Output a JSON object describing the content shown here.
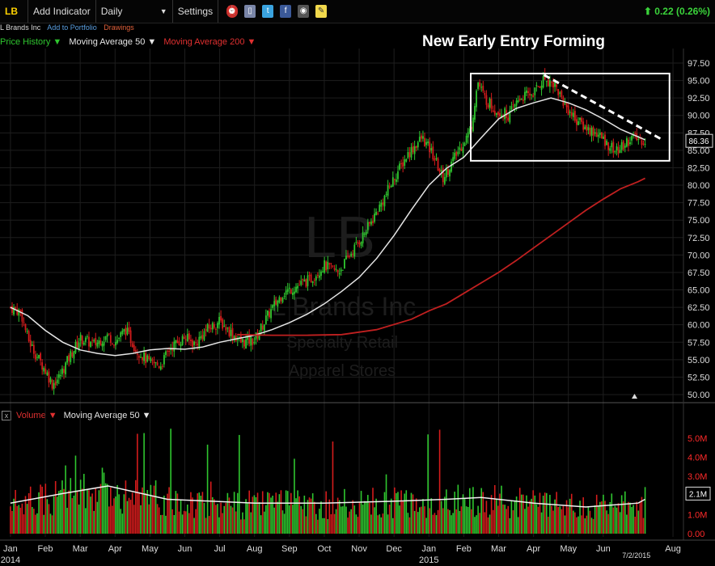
{
  "toolbar": {
    "symbol": "LB",
    "add_indicator": "Add Indicator",
    "period": "Daily",
    "period_arrow": "▼",
    "settings": "Settings",
    "change": "0.22 (0.26%)",
    "change_arrow": "⬆",
    "icons": [
      "alarm-icon",
      "mobile-icon",
      "twitter-icon",
      "facebook-icon",
      "camera-icon",
      "note-icon"
    ]
  },
  "company": {
    "name": "L Brands Inc",
    "add_portfolio": "Add to Portfolio",
    "drawings": "Drawings"
  },
  "legend": {
    "price_history": "Price History ▼",
    "ma50": "Moving Average 50 ▼",
    "ma200": "Moving Average 200 ▼"
  },
  "volume_legend": {
    "close": "x",
    "volume": "Volume ▼",
    "ma50": "Moving Average 50 ▼"
  },
  "colors": {
    "up": "#2fc62f",
    "down": "#d41c1c",
    "ma50": "#e6e6e6",
    "ma200": "#c02020",
    "price_axis": "#dddddd",
    "vol_axis": "#ff2a2a"
  },
  "chart_data": {
    "type": "candlestick",
    "title": "New Early Entry Forming",
    "watermark": {
      "symbol": "LB",
      "name": "L Brands Inc",
      "sector": "Specialty Retail",
      "industry": "Apparel Stores"
    },
    "last_price": "86.36",
    "last_volume": "2.1M",
    "date_label": "7/2/2015",
    "x_labels": [
      {
        "label": "Jan",
        "t": 0
      },
      {
        "label": "Feb",
        "t": 1
      },
      {
        "label": "Mar",
        "t": 2
      },
      {
        "label": "Apr",
        "t": 3
      },
      {
        "label": "May",
        "t": 4
      },
      {
        "label": "Jun",
        "t": 5
      },
      {
        "label": "Jul",
        "t": 6
      },
      {
        "label": "Aug",
        "t": 7
      },
      {
        "label": "Sep",
        "t": 8
      },
      {
        "label": "Oct",
        "t": 9
      },
      {
        "label": "Nov",
        "t": 10
      },
      {
        "label": "Dec",
        "t": 11
      },
      {
        "label": "Jan",
        "t": 12
      },
      {
        "label": "Feb",
        "t": 13
      },
      {
        "label": "Mar",
        "t": 14
      },
      {
        "label": "Apr",
        "t": 15
      },
      {
        "label": "May",
        "t": 16
      },
      {
        "label": "Jun",
        "t": 17
      },
      {
        "label": "Aug",
        "t": 19
      }
    ],
    "year_labels": [
      {
        "label": "2014",
        "t": 0
      },
      {
        "label": "2015",
        "t": 12
      }
    ],
    "x_range_months": [
      -0.3,
      19.3
    ],
    "y_ticks": [
      "97.50",
      "95.00",
      "92.50",
      "90.00",
      "87.50",
      "85.00",
      "82.50",
      "80.00",
      "77.50",
      "75.00",
      "72.50",
      "70.00",
      "67.50",
      "65.00",
      "62.50",
      "60.00",
      "57.50",
      "55.00",
      "52.50",
      "50.00"
    ],
    "ylim": [
      50.0,
      97.5
    ],
    "price_path": [
      [
        0,
        62.5
      ],
      [
        0.3,
        61.8
      ],
      [
        0.5,
        58
      ],
      [
        0.7,
        56
      ],
      [
        1.0,
        53.5
      ],
      [
        1.2,
        51.5
      ],
      [
        1.4,
        52.5
      ],
      [
        1.7,
        55.5
      ],
      [
        2.0,
        58
      ],
      [
        2.4,
        57.2
      ],
      [
        2.8,
        58.5
      ],
      [
        3.0,
        57.5
      ],
      [
        3.3,
        59.3
      ],
      [
        3.6,
        56.5
      ],
      [
        4.0,
        54.5
      ],
      [
        4.3,
        54.2
      ],
      [
        4.6,
        56.8
      ],
      [
        5.0,
        58.2
      ],
      [
        5.3,
        57.2
      ],
      [
        5.6,
        59.2
      ],
      [
        6.0,
        60.5
      ],
      [
        6.3,
        59
      ],
      [
        6.6,
        57.5
      ],
      [
        7.0,
        57.8
      ],
      [
        7.4,
        61.5
      ],
      [
        7.8,
        64.5
      ],
      [
        8.2,
        65.5
      ],
      [
        8.6,
        66.5
      ],
      [
        9.0,
        68.5
      ],
      [
        9.4,
        67.5
      ],
      [
        9.8,
        70.5
      ],
      [
        10.2,
        73.5
      ],
      [
        10.6,
        77
      ],
      [
        11.0,
        81
      ],
      [
        11.4,
        84.5
      ],
      [
        11.8,
        86.8
      ],
      [
        12.1,
        84.5
      ],
      [
        12.4,
        81
      ],
      [
        12.8,
        84.5
      ],
      [
        13.2,
        88
      ],
      [
        13.4,
        94.8
      ],
      [
        13.6,
        92.5
      ],
      [
        13.9,
        90.8
      ],
      [
        14.3,
        90
      ],
      [
        14.6,
        92.5
      ],
      [
        15.0,
        93.2
      ],
      [
        15.3,
        95.3
      ],
      [
        15.6,
        94.5
      ],
      [
        15.9,
        91.5
      ],
      [
        16.2,
        89.5
      ],
      [
        16.5,
        88.2
      ],
      [
        16.8,
        87.5
      ],
      [
        17.1,
        86
      ],
      [
        17.4,
        84.8
      ],
      [
        17.8,
        86.8
      ],
      [
        18.2,
        86.36
      ]
    ],
    "ma50_path": [
      [
        0,
        62.5
      ],
      [
        0.5,
        61.3
      ],
      [
        1.0,
        59.2
      ],
      [
        1.5,
        57.5
      ],
      [
        2.0,
        56.4
      ],
      [
        2.5,
        55.9
      ],
      [
        3.0,
        55.6
      ],
      [
        3.5,
        55.9
      ],
      [
        4.0,
        56.4
      ],
      [
        4.5,
        56.6
      ],
      [
        5.0,
        56.5
      ],
      [
        5.5,
        56.8
      ],
      [
        6.0,
        57.5
      ],
      [
        6.5,
        58.0
      ],
      [
        7.0,
        58.5
      ],
      [
        7.5,
        59.3
      ],
      [
        8.0,
        60.3
      ],
      [
        8.5,
        61.5
      ],
      [
        9.0,
        63.0
      ],
      [
        9.5,
        64.8
      ],
      [
        10.0,
        66.8
      ],
      [
        10.5,
        69.5
      ],
      [
        11.0,
        72.8
      ],
      [
        11.5,
        76.5
      ],
      [
        12.0,
        80.0
      ],
      [
        12.5,
        82.4
      ],
      [
        13.0,
        84.0
      ],
      [
        13.5,
        86.8
      ],
      [
        14.0,
        89.5
      ],
      [
        14.5,
        91.0
      ],
      [
        15.0,
        91.8
      ],
      [
        15.5,
        92.5
      ],
      [
        16.0,
        91.8
      ],
      [
        16.5,
        90.8
      ],
      [
        17.0,
        89.5
      ],
      [
        17.5,
        88.0
      ],
      [
        18.2,
        86.5
      ]
    ],
    "ma200_path": [
      [
        6.5,
        58.6
      ],
      [
        7.5,
        58.5
      ],
      [
        8.5,
        58.5
      ],
      [
        9.5,
        58.6
      ],
      [
        10.5,
        59.3
      ],
      [
        11.5,
        60.8
      ],
      [
        12.0,
        62.0
      ],
      [
        12.5,
        63.0
      ],
      [
        13.0,
        64.5
      ],
      [
        13.5,
        66.0
      ],
      [
        14.0,
        67.5
      ],
      [
        14.5,
        69.2
      ],
      [
        15.0,
        71.0
      ],
      [
        15.5,
        72.8
      ],
      [
        16.0,
        74.6
      ],
      [
        16.5,
        76.4
      ],
      [
        17.0,
        78.0
      ],
      [
        17.5,
        79.5
      ],
      [
        18.0,
        80.5
      ],
      [
        18.2,
        81.0
      ]
    ],
    "trendline": [
      [
        15.3,
        95.8
      ],
      [
        18.7,
        86.5
      ]
    ],
    "highlight_box": {
      "t0": 13.2,
      "t1": 18.9,
      "y0": 83.5,
      "y1": 96.0
    },
    "volume": {
      "y_ticks": [
        "5.0M",
        "4.0M",
        "3.0M",
        "2.0M",
        "1.0M",
        "0.00"
      ],
      "ylim": [
        0,
        5.5
      ],
      "ma_path": [
        [
          0,
          1.6
        ],
        [
          1.5,
          2.1
        ],
        [
          2.8,
          2.5
        ],
        [
          4.5,
          1.8
        ],
        [
          7.0,
          1.6
        ],
        [
          9.0,
          1.6
        ],
        [
          11.0,
          1.7
        ],
        [
          12.5,
          1.8
        ],
        [
          13.5,
          1.9
        ],
        [
          15.0,
          1.6
        ],
        [
          16.5,
          1.4
        ],
        [
          18.0,
          1.6
        ],
        [
          18.2,
          1.8
        ]
      ]
    }
  }
}
